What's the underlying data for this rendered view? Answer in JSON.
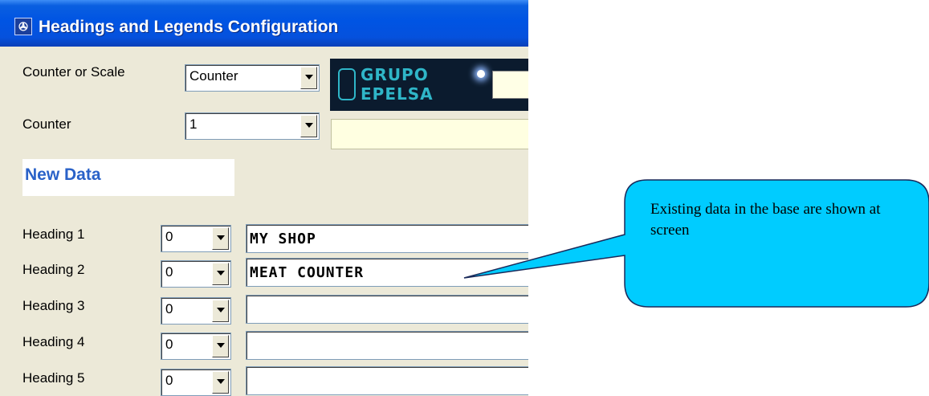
{
  "window": {
    "title": "Headings and Legends Configuration",
    "title_icon": "app-icon"
  },
  "selectors": {
    "counter_or_scale": {
      "label": "Counter or Scale",
      "value": "Counter"
    },
    "counter": {
      "label": "Counter",
      "value": "1"
    }
  },
  "logo": {
    "line1": "GRUPO",
    "line2": "EPELSA"
  },
  "new_data": {
    "label": "New Data"
  },
  "headings": [
    {
      "label": "Heading 1",
      "select": "0",
      "value": "MY SHOP"
    },
    {
      "label": "Heading 2",
      "select": "0",
      "value": "MEAT COUNTER"
    },
    {
      "label": "Heading 3",
      "select": "0",
      "value": ""
    },
    {
      "label": "Heading 4",
      "select": "0",
      "value": ""
    },
    {
      "label": "Heading 5",
      "select": "0",
      "value": ""
    }
  ],
  "callout": {
    "text": "Existing data in the base are shown at screen",
    "fill_color": "#00ccff"
  },
  "colors": {
    "titlebar": "#0054e3",
    "window_bg": "#ece9d8",
    "new_data_text": "#2a62c8"
  }
}
